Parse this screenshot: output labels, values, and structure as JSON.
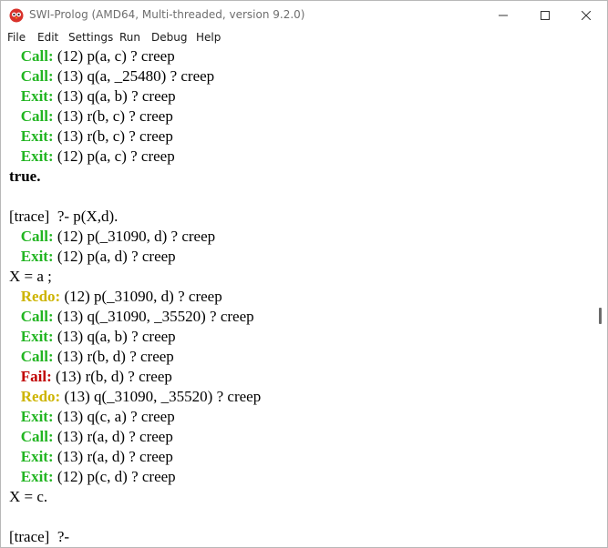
{
  "window": {
    "title": "SWI-Prolog (AMD64, Multi-threaded, version 9.2.0)",
    "minimize_glyph": "—",
    "maximize_glyph": "☐",
    "close_glyph": "✕"
  },
  "menu": [
    "File",
    "Edit",
    "Settings",
    "Run",
    "Debug",
    "Help"
  ],
  "console": {
    "lines": [
      {
        "indent": "   ",
        "kw": "Call:",
        "kind": "call",
        "text": " (12) p(a, c) ? creep"
      },
      {
        "indent": "   ",
        "kw": "Call:",
        "kind": "call",
        "text": " (13) q(a, _25480) ? creep"
      },
      {
        "indent": "   ",
        "kw": "Exit:",
        "kind": "exit",
        "text": " (13) q(a, b) ? creep"
      },
      {
        "indent": "   ",
        "kw": "Call:",
        "kind": "call",
        "text": " (13) r(b, c) ? creep"
      },
      {
        "indent": "   ",
        "kw": "Exit:",
        "kind": "exit",
        "text": " (13) r(b, c) ? creep"
      },
      {
        "indent": "   ",
        "kw": "Exit:",
        "kind": "exit",
        "text": " (12) p(a, c) ? creep"
      },
      {
        "indent": "",
        "kw": "",
        "kind": "bold",
        "text": "true."
      },
      {
        "indent": "",
        "kw": "",
        "kind": "plain",
        "text": ""
      },
      {
        "indent": "",
        "kw": "",
        "kind": "plain",
        "text": "[trace]  ?- p(X,d)."
      },
      {
        "indent": "   ",
        "kw": "Call:",
        "kind": "call",
        "text": " (12) p(_31090, d) ? creep"
      },
      {
        "indent": "   ",
        "kw": "Exit:",
        "kind": "exit",
        "text": " (12) p(a, d) ? creep"
      },
      {
        "indent": "",
        "kw": "",
        "kind": "plain",
        "text": "X = a ;"
      },
      {
        "indent": "   ",
        "kw": "Redo:",
        "kind": "redo",
        "text": " (12) p(_31090, d) ? creep"
      },
      {
        "indent": "   ",
        "kw": "Call:",
        "kind": "call",
        "text": " (13) q(_31090, _35520) ? creep"
      },
      {
        "indent": "   ",
        "kw": "Exit:",
        "kind": "exit",
        "text": " (13) q(a, b) ? creep"
      },
      {
        "indent": "   ",
        "kw": "Call:",
        "kind": "call",
        "text": " (13) r(b, d) ? creep"
      },
      {
        "indent": "   ",
        "kw": "Fail:",
        "kind": "fail",
        "text": " (13) r(b, d) ? creep"
      },
      {
        "indent": "   ",
        "kw": "Redo:",
        "kind": "redo",
        "text": " (13) q(_31090, _35520) ? creep"
      },
      {
        "indent": "   ",
        "kw": "Exit:",
        "kind": "exit",
        "text": " (13) q(c, a) ? creep"
      },
      {
        "indent": "   ",
        "kw": "Call:",
        "kind": "call",
        "text": " (13) r(a, d) ? creep"
      },
      {
        "indent": "   ",
        "kw": "Exit:",
        "kind": "exit",
        "text": " (13) r(a, d) ? creep"
      },
      {
        "indent": "   ",
        "kw": "Exit:",
        "kind": "exit",
        "text": " (12) p(c, d) ? creep"
      },
      {
        "indent": "",
        "kw": "",
        "kind": "plain",
        "text": "X = c."
      },
      {
        "indent": "",
        "kw": "",
        "kind": "plain",
        "text": ""
      },
      {
        "indent": "",
        "kw": "",
        "kind": "plain",
        "text": "[trace]  ?-"
      }
    ]
  },
  "colors": {
    "call_exit": "#22b522",
    "redo": "#cdb400",
    "fail": "#c00000",
    "icon_red": "#d9322b"
  }
}
